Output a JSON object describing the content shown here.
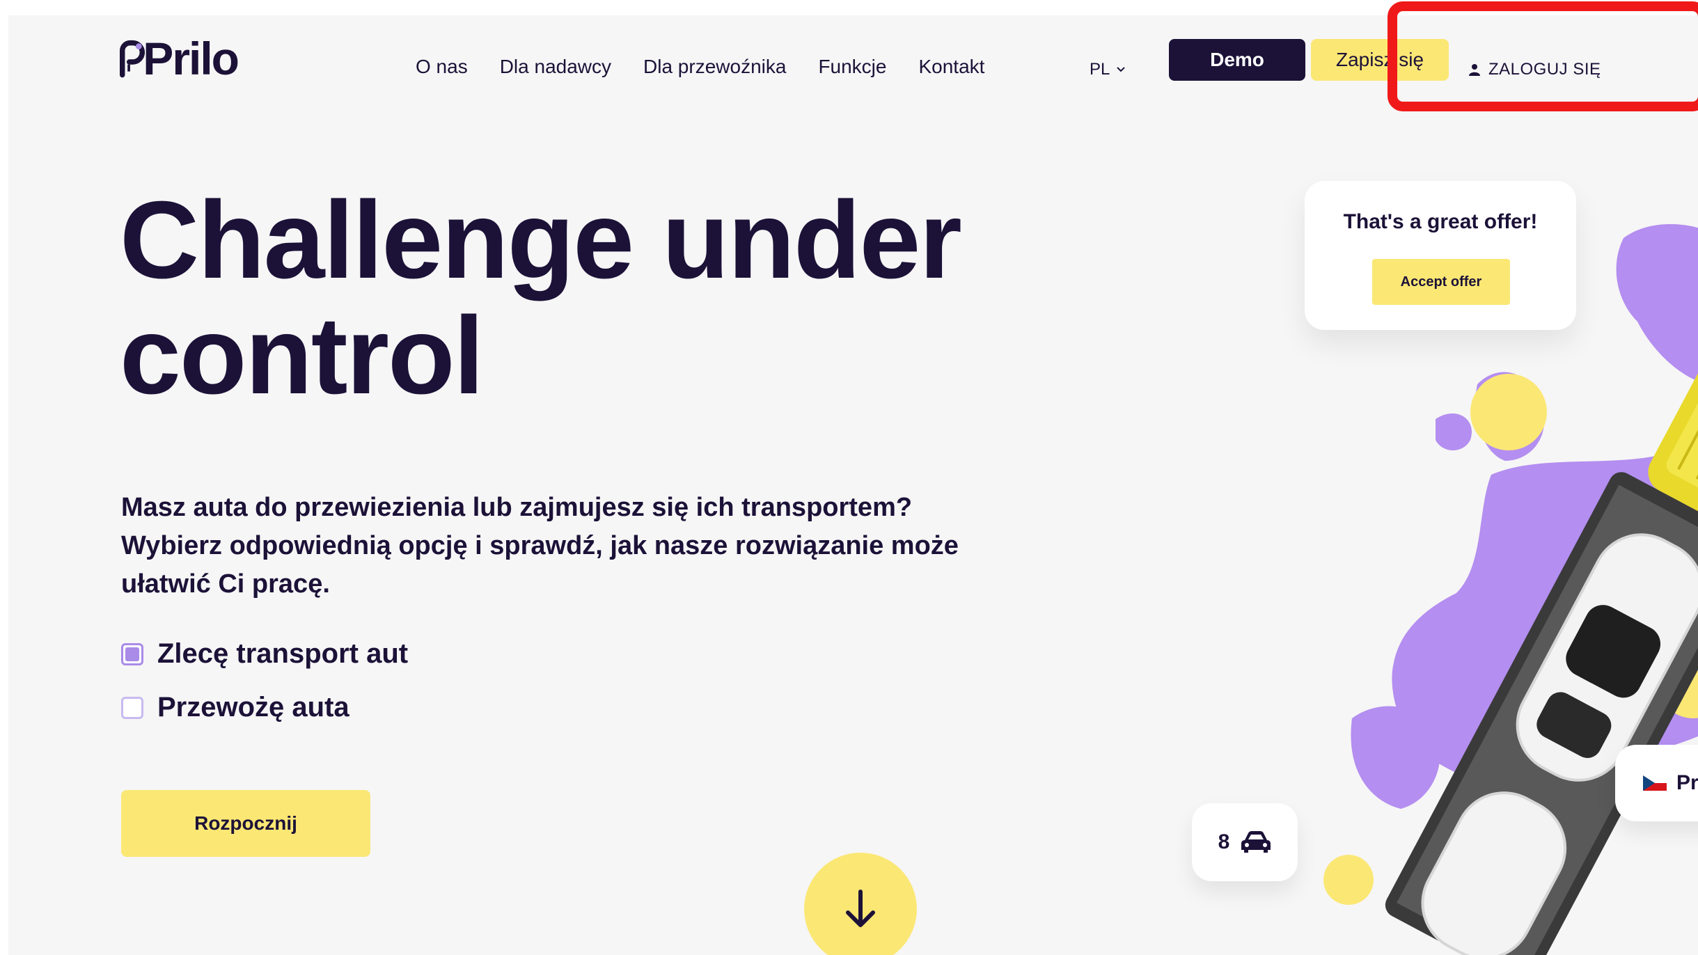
{
  "brand": {
    "name": "Prilo",
    "colors": {
      "dark": "#1c1238",
      "yellow": "#fbe774",
      "purple": "#a98be8",
      "background": "#f6f6f6",
      "highlight": "#f01919"
    }
  },
  "nav": {
    "items": [
      "O nas",
      "Dla nadawcy",
      "Dla przewoźnika",
      "Funkcje",
      "Kontakt"
    ],
    "language": "PL",
    "demo_label": "Demo",
    "signup_label": "Zapisz się",
    "login_label": "ZALOGUJ SIĘ"
  },
  "hero": {
    "title_line1": "Challenge under",
    "title_line2": "control",
    "description": "Masz auta do przewiezienia lub zajmujesz się ich transportem? Wybierz odpowiednią opcję i sprawdź, jak nasze rozwiązanie może ułatwić Ci pracę.",
    "options": [
      {
        "label": "Zlecę transport aut",
        "checked": true
      },
      {
        "label": "Przewożę auta",
        "checked": false
      }
    ],
    "start_label": "Rozpocznij"
  },
  "illustration": {
    "offer_title": "That's a great offer!",
    "accept_label": "Accept offer",
    "car_count": "8",
    "location_partial": "Pra"
  },
  "icons": [
    "prilo-logo-icon",
    "chevron-down-icon",
    "user-icon",
    "arrow-down-icon",
    "car-icon",
    "czech-flag-icon"
  ]
}
